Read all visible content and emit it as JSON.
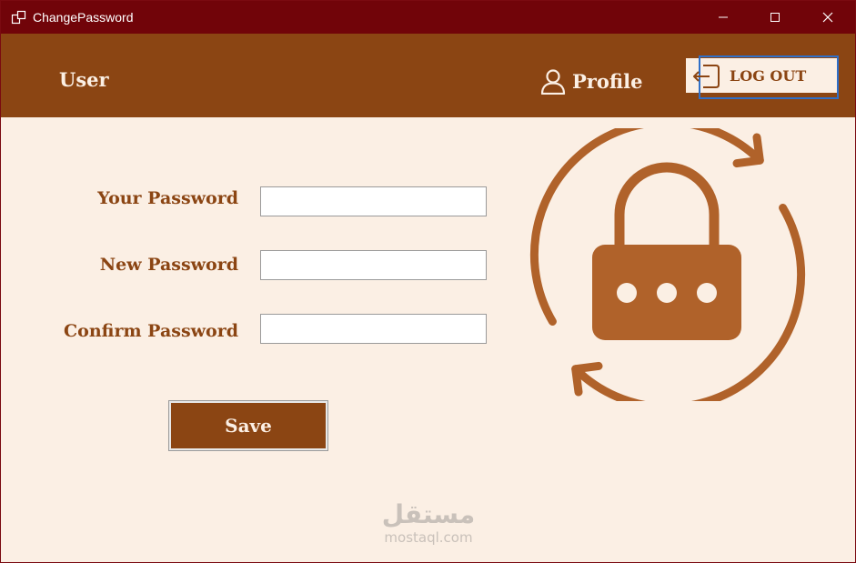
{
  "window": {
    "title": "ChangePassword"
  },
  "header": {
    "user_label": "User",
    "profile_label": "Profile",
    "logout_label": "LOG OUT"
  },
  "form": {
    "your_password_label": "Your Password",
    "new_password_label": "New Password",
    "confirm_password_label": "Confirm Password",
    "your_password_value": "",
    "new_password_value": "",
    "confirm_password_value": "",
    "save_label": "Save"
  },
  "watermark": {
    "arabic": "مستقل",
    "site": "mostaql.com"
  },
  "icons": [
    "app-icon",
    "minimize-icon",
    "maximize-icon",
    "close-icon",
    "user-icon",
    "logout-icon",
    "lock-refresh-icon"
  ],
  "colors": {
    "titlebar": "#710409",
    "header": "#8b4513",
    "background": "#fbefe4",
    "accent": "#b0622a"
  }
}
